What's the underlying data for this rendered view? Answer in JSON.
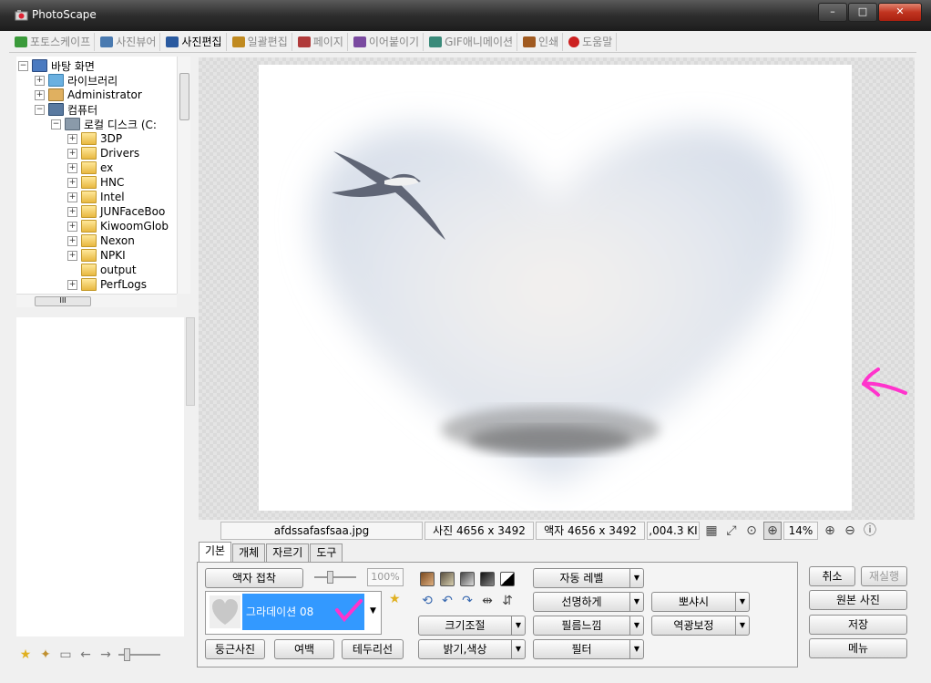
{
  "window": {
    "title": "PhotoScape",
    "controls": [
      "–",
      "□",
      "✕"
    ]
  },
  "menu": {
    "tabs": [
      {
        "label": "포토스케이프",
        "active": false,
        "color": "#3a9a3a"
      },
      {
        "label": "사진뷰어",
        "active": false,
        "color": "#4a7ab0"
      },
      {
        "label": "사진편집",
        "active": true,
        "color": "#2a5aa0"
      },
      {
        "label": "일괄편집",
        "active": false,
        "color": "#c08a20"
      },
      {
        "label": "페이지",
        "active": false,
        "color": "#b03a3a"
      },
      {
        "label": "이어붙이기",
        "active": false,
        "color": "#7a4aa0"
      },
      {
        "label": "GIF애니메이션",
        "active": false,
        "color": "#3a8a7a"
      },
      {
        "label": "인쇄",
        "active": false,
        "color": "#a05a20"
      },
      {
        "label": "도움말",
        "active": false,
        "color": "#cc2020"
      }
    ]
  },
  "tree": {
    "items": [
      {
        "label": "바탕 화면",
        "level": 0,
        "expander": "−",
        "icon": "desktop-icon"
      },
      {
        "label": "라이브러리",
        "level": 1,
        "expander": "+",
        "icon": "library-icon"
      },
      {
        "label": "Administrator",
        "level": 1,
        "expander": "+",
        "icon": "user-icon"
      },
      {
        "label": "컴퓨터",
        "level": 1,
        "expander": "−",
        "icon": "computer-icon"
      },
      {
        "label": "로컬 디스크 (C:",
        "level": 2,
        "expander": "−",
        "icon": "drive-icon"
      },
      {
        "label": "3DP",
        "level": 3,
        "expander": "+",
        "icon": "folder-icon"
      },
      {
        "label": "Drivers",
        "level": 3,
        "expander": "+",
        "icon": "folder-icon"
      },
      {
        "label": "ex",
        "level": 3,
        "expander": "+",
        "icon": "folder-icon"
      },
      {
        "label": "HNC",
        "level": 3,
        "expander": "+",
        "icon": "folder-icon"
      },
      {
        "label": "Intel",
        "level": 3,
        "expander": "+",
        "icon": "folder-icon"
      },
      {
        "label": "JUNFaceBoo",
        "level": 3,
        "expander": "+",
        "icon": "folder-icon"
      },
      {
        "label": "KiwoomGlob",
        "level": 3,
        "expander": "+",
        "icon": "folder-icon"
      },
      {
        "label": "Nexon",
        "level": 3,
        "expander": "+",
        "icon": "folder-icon"
      },
      {
        "label": "NPKI",
        "level": 3,
        "expander": "+",
        "icon": "folder-icon"
      },
      {
        "label": "output",
        "level": 3,
        "expander": "",
        "icon": "folder-icon"
      },
      {
        "label": "PerfLogs",
        "level": 3,
        "expander": "+",
        "icon": "folder-icon"
      }
    ],
    "hscroll_label": "III"
  },
  "status": {
    "filename": "afdssafasfsaa.jpg",
    "photo_size": "사진 4656 x 3492",
    "frame_size": "액자 4656 x 3492",
    "file_size": ",004.3 KI",
    "zoom": "14%"
  },
  "bottom": {
    "tabs": [
      "기본",
      "개체",
      "자르기",
      "도구"
    ],
    "frame_fit_label": "액자 접착",
    "frame_percent": "100%",
    "frame_selected": "그라데이션 08",
    "round_photo": "둥근사진",
    "margin": "여백",
    "border": "테두리선",
    "resize": "크기조절",
    "bright_color": "밝기,색상",
    "auto_level": "자동 레벨",
    "sharpen": "선명하게",
    "film_effect": "필름느낌",
    "filter": "필터",
    "soften": "뽀샤시",
    "backlight": "역광보정"
  },
  "actions": {
    "undo": "취소",
    "redo": "재실행",
    "original": "원본 사진",
    "save": "저장",
    "menu": "메뉴"
  }
}
